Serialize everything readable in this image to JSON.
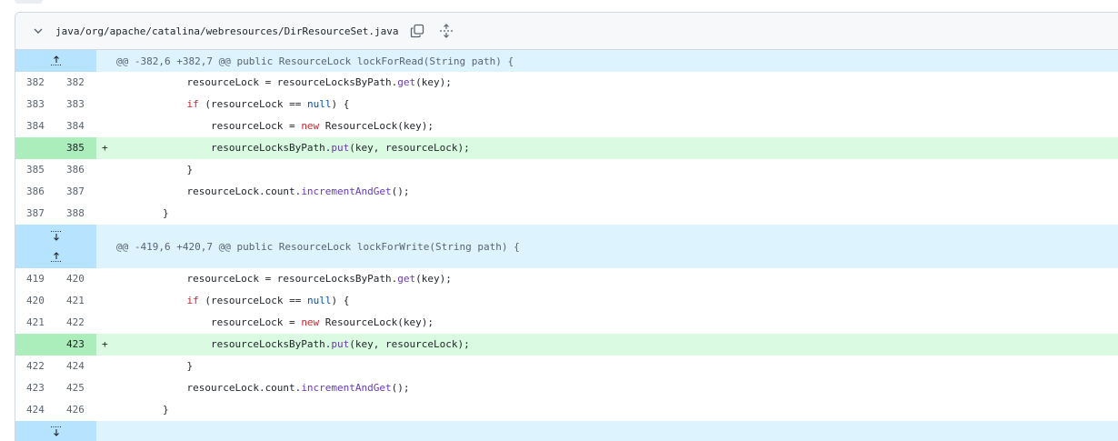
{
  "file": {
    "path": "java/org/apache/catalina/webresources/DirResourceSet.java"
  },
  "icons": {
    "chevron": "chevron-down-icon",
    "copy": "copy-icon",
    "expand_all": "unfold-icon",
    "expand_up": "fold-up-icon",
    "expand_down": "fold-down-icon"
  },
  "colors": {
    "hunk_bg": "#ddf4ff",
    "hunk_gutter": "#b6e3ff",
    "add_bg": "#dafbe1",
    "add_gutter": "#aceebb",
    "keyword": "#cf222e",
    "function": "#6639ba",
    "constant": "#0550ae"
  },
  "hunks": [
    {
      "header": "@@ -382,6 +382,7 @@ public ResourceLock lockForRead(String path) {"
    },
    {
      "header": "@@ -419,6 +420,7 @@ public ResourceLock lockForWrite(String path) {"
    }
  ],
  "block1": [
    {
      "old": "382",
      "new": "382",
      "sign": "",
      "pre": "            resourceLock = resourceLocksByPath.",
      "tok": "get",
      "post": "(key);"
    },
    {
      "old": "383",
      "new": "383",
      "sign": "",
      "pre": "            ",
      "kw": "if",
      "mid": " (resourceLock == ",
      "const": "null",
      "post": ") {"
    },
    {
      "old": "384",
      "new": "384",
      "sign": "",
      "pre": "                resourceLock = ",
      "kw": "new",
      "post": " ResourceLock(key);"
    },
    {
      "old": "",
      "new": "385",
      "sign": "+",
      "pre": "                resourceLocksByPath.",
      "tok": "put",
      "post": "(key, resourceLock);"
    },
    {
      "old": "385",
      "new": "386",
      "sign": "",
      "pre": "            }"
    },
    {
      "old": "386",
      "new": "387",
      "sign": "",
      "pre": "            resourceLock.count.",
      "tok": "incrementAndGet",
      "post": "();"
    },
    {
      "old": "387",
      "new": "388",
      "sign": "",
      "pre": "        }"
    }
  ],
  "block2": [
    {
      "old": "419",
      "new": "420",
      "sign": "",
      "pre": "            resourceLock = resourceLocksByPath.",
      "tok": "get",
      "post": "(key);"
    },
    {
      "old": "420",
      "new": "421",
      "sign": "",
      "pre": "            ",
      "kw": "if",
      "mid": " (resourceLock == ",
      "const": "null",
      "post": ") {"
    },
    {
      "old": "421",
      "new": "422",
      "sign": "",
      "pre": "                resourceLock = ",
      "kw": "new",
      "post": " ResourceLock(key);"
    },
    {
      "old": "",
      "new": "423",
      "sign": "+",
      "pre": "                resourceLocksByPath.",
      "tok": "put",
      "post": "(key, resourceLock);"
    },
    {
      "old": "422",
      "new": "424",
      "sign": "",
      "pre": "            }"
    },
    {
      "old": "423",
      "new": "425",
      "sign": "",
      "pre": "            resourceLock.count.",
      "tok": "incrementAndGet",
      "post": "();"
    },
    {
      "old": "424",
      "new": "426",
      "sign": "",
      "pre": "        }"
    }
  ]
}
